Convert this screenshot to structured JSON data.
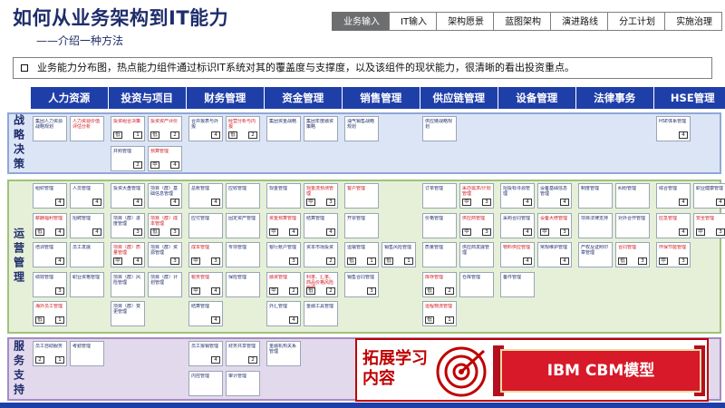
{
  "title": "如何从业务架构到IT能力",
  "subtitle": "——介绍一种方法",
  "process_steps": [
    "业务输入",
    "IT输入",
    "架构愿景",
    "蓝图架构",
    "演进路线",
    "分工计划",
    "实施治理"
  ],
  "active_step": 0,
  "note": "业务能力分布图，热点能力组件通过标识IT系统对其的覆盖度与支撑度，以及该组件的现状能力，很清晰的看出投资重点。",
  "columns": [
    "人力资源",
    "投资与项目",
    "财务管理",
    "资金管理",
    "销售管理",
    "供应链管理",
    "设备管理",
    "法律事务",
    "HSE管理"
  ],
  "bands": [
    {
      "name": "战略决策",
      "key": "strategy"
    },
    {
      "name": "运营管理",
      "key": "ops"
    },
    {
      "name": "服务支持",
      "key": "support"
    }
  ],
  "cells": [
    {
      "b": "strategy",
      "c": 0,
      "r": 0,
      "name": "集团人力资源战略规划",
      "hot": false,
      "l": "",
      "v": ""
    },
    {
      "b": "strategy",
      "c": 0,
      "r": 0,
      "name": "人力资源价值评估分析",
      "hot": true,
      "l": "",
      "v": ""
    },
    {
      "b": "strategy",
      "c": 1,
      "r": 0,
      "name": "投资组合决策",
      "hot": true,
      "l": "低",
      "v": "1"
    },
    {
      "b": "strategy",
      "c": 1,
      "r": 0,
      "name": "投资资产评价",
      "hot": true,
      "l": "低",
      "v": "2"
    },
    {
      "b": "strategy",
      "c": 1,
      "r": 1,
      "name": "并购管理",
      "hot": false,
      "l": "",
      "v": "2"
    },
    {
      "b": "strategy",
      "c": 1,
      "r": 1,
      "name": "预算管理",
      "hot": true,
      "l": "中",
      "v": "4"
    },
    {
      "b": "strategy",
      "c": 2,
      "r": 0,
      "name": "合并报表与外报",
      "hot": false,
      "l": "",
      "v": "4"
    },
    {
      "b": "strategy",
      "c": 2,
      "r": 0,
      "name": "经营分析与内报",
      "hot": true,
      "l": "低",
      "v": "2"
    },
    {
      "b": "strategy",
      "c": 3,
      "r": 0,
      "name": "集团资金战略",
      "hot": false,
      "l": "",
      "v": ""
    },
    {
      "b": "strategy",
      "c": 3,
      "r": 0,
      "name": "集团年度融资策略",
      "hot": false,
      "l": "",
      "v": ""
    },
    {
      "b": "strategy",
      "c": 4,
      "r": 0,
      "name": "油气销售战略规划",
      "hot": false,
      "l": "",
      "v": ""
    },
    {
      "b": "strategy",
      "c": 5,
      "r": 0,
      "name": "供应链战略规划",
      "hot": false,
      "l": "",
      "v": ""
    },
    {
      "b": "strategy",
      "c": 8,
      "r": 0,
      "name": "HSE体系管理",
      "hot": false,
      "l": "",
      "v": "4"
    },
    {
      "b": "ops",
      "c": 0,
      "r": 0,
      "name": "组织管理",
      "hot": false,
      "l": "",
      "v": "4"
    },
    {
      "b": "ops",
      "c": 0,
      "r": 0,
      "name": "人员管理",
      "hot": false,
      "l": "",
      "v": "4"
    },
    {
      "b": "ops",
      "c": 0,
      "r": 1,
      "name": "薪酬福利管理",
      "hot": true,
      "l": "低",
      "v": "4"
    },
    {
      "b": "ops",
      "c": 0,
      "r": 1,
      "name": "招聘管理",
      "hot": false,
      "l": "",
      "v": "4"
    },
    {
      "b": "ops",
      "c": 0,
      "r": 2,
      "name": "培训管理",
      "hot": false,
      "l": "",
      "v": "4"
    },
    {
      "b": "ops",
      "c": 0,
      "r": 2,
      "name": "员工发展",
      "hot": false,
      "l": "",
      "v": ""
    },
    {
      "b": "ops",
      "c": 0,
      "r": 3,
      "name": "绩效管理",
      "hot": false,
      "l": "",
      "v": "3"
    },
    {
      "b": "ops",
      "c": 0,
      "r": 3,
      "name": "职业资格管理",
      "hot": false,
      "l": "",
      "v": ""
    },
    {
      "b": "ops",
      "c": 0,
      "r": 4,
      "name": "海外员工管理",
      "hot": true,
      "l": "低",
      "v": "1"
    },
    {
      "b": "ops",
      "c": 1,
      "r": 0,
      "name": "投资大盘管理",
      "hot": false,
      "l": "",
      "v": "4"
    },
    {
      "b": "ops",
      "c": 1,
      "r": 0,
      "name": "项目（群）基础信息管理",
      "hot": false,
      "l": "",
      "v": "4"
    },
    {
      "b": "ops",
      "c": 1,
      "r": 1,
      "name": "项目（群）进度管理",
      "hot": false,
      "l": "",
      "v": "3"
    },
    {
      "b": "ops",
      "c": 1,
      "r": 1,
      "name": "项目（群）成本管理",
      "hot": true,
      "l": "低",
      "v": "3"
    },
    {
      "b": "ops",
      "c": 1,
      "r": 2,
      "name": "项目（群）质量管理",
      "hot": true,
      "l": "中",
      "v": "4"
    },
    {
      "b": "ops",
      "c": 1,
      "r": 2,
      "name": "项目（群）资源管理",
      "hot": false,
      "l": "",
      "v": "3"
    },
    {
      "b": "ops",
      "c": 1,
      "r": 3,
      "name": "项目（群）风险管理",
      "hot": false,
      "l": "",
      "v": ""
    },
    {
      "b": "ops",
      "c": 1,
      "r": 3,
      "name": "项目（群）计划管理",
      "hot": false,
      "l": "",
      "v": ""
    },
    {
      "b": "ops",
      "c": 1,
      "r": 4,
      "name": "项目（群）变更管理",
      "hot": false,
      "l": "",
      "v": ""
    },
    {
      "b": "ops",
      "c": 2,
      "r": 0,
      "name": "总账管理",
      "hot": false,
      "l": "",
      "v": "4"
    },
    {
      "b": "ops",
      "c": 2,
      "r": 0,
      "name": "应收管理",
      "hot": false,
      "l": "",
      "v": ""
    },
    {
      "b": "ops",
      "c": 2,
      "r": 1,
      "name": "应付管理",
      "hot": false,
      "l": "",
      "v": ""
    },
    {
      "b": "ops",
      "c": 2,
      "r": 1,
      "name": "固定资产管理",
      "hot": false,
      "l": "",
      "v": ""
    },
    {
      "b": "ops",
      "c": 2,
      "r": 2,
      "name": "成本管理",
      "hot": true,
      "l": "中",
      "v": "3"
    },
    {
      "b": "ops",
      "c": 2,
      "r": 2,
      "name": "专项管理",
      "hot": false,
      "l": "",
      "v": ""
    },
    {
      "b": "ops",
      "c": 2,
      "r": 3,
      "name": "税务管理",
      "hot": true,
      "l": "中",
      "v": "4"
    },
    {
      "b": "ops",
      "c": 2,
      "r": 3,
      "name": "保险管理",
      "hot": false,
      "l": "",
      "v": ""
    },
    {
      "b": "ops",
      "c": 2,
      "r": 4,
      "name": "结算管理",
      "hot": false,
      "l": "",
      "v": "4"
    },
    {
      "b": "ops",
      "c": 3,
      "r": 0,
      "name": "现金管理",
      "hot": false,
      "l": "",
      "v": ""
    },
    {
      "b": "ops",
      "c": 3,
      "r": 0,
      "name": "现金流预测管理",
      "hot": true,
      "l": "中",
      "v": "3"
    },
    {
      "b": "ops",
      "c": 3,
      "r": 1,
      "name": "资金预算管理",
      "hot": true,
      "l": "中",
      "v": "4"
    },
    {
      "b": "ops",
      "c": 3,
      "r": 1,
      "name": "结算管理",
      "hot": false,
      "l": "",
      "v": "4"
    },
    {
      "b": "ops",
      "c": 3,
      "r": 2,
      "name": "银行账户管理",
      "hot": false,
      "l": "",
      "v": "3"
    },
    {
      "b": "ops",
      "c": 3,
      "r": 2,
      "name": "资本市场投资",
      "hot": false,
      "l": "",
      "v": "2"
    },
    {
      "b": "ops",
      "c": 3,
      "r": 3,
      "name": "融资管理",
      "hot": true,
      "l": "中",
      "v": "2"
    },
    {
      "b": "ops",
      "c": 3,
      "r": 3,
      "name": "利率、汇率、商品价格风险管理",
      "hot": true,
      "l": "低",
      "v": "2"
    },
    {
      "b": "ops",
      "c": 3,
      "r": 4,
      "name": "外汇管理",
      "hot": false,
      "l": "",
      "v": "4"
    },
    {
      "b": "ops",
      "c": 3,
      "r": 4,
      "name": "金融工具管理",
      "hot": false,
      "l": "",
      "v": ""
    },
    {
      "b": "ops",
      "c": 4,
      "r": 0,
      "name": "客户管理",
      "hot": true,
      "l": "",
      "v": ""
    },
    {
      "b": "ops",
      "c": 4,
      "r": 1,
      "name": "开票管理",
      "hot": false,
      "l": "",
      "v": ""
    },
    {
      "b": "ops",
      "c": 4,
      "r": 2,
      "name": "运输管理",
      "hot": false,
      "l": "低",
      "v": "1"
    },
    {
      "b": "ops",
      "c": 4,
      "r": 2,
      "name": "销售风险管理",
      "hot": false,
      "l": "低",
      "v": "1"
    },
    {
      "b": "ops",
      "c": 4,
      "r": 3,
      "name": "销售合同管理",
      "hot": false,
      "l": "",
      "v": "3"
    },
    {
      "b": "ops",
      "c": 5,
      "r": 0,
      "name": "订单管理",
      "hot": false,
      "l": "",
      "v": ""
    },
    {
      "b": "ops",
      "c": 5,
      "r": 0,
      "name": "采办需求/计划管理",
      "hot": true,
      "l": "中",
      "v": "3"
    },
    {
      "b": "ops",
      "c": 5,
      "r": 1,
      "name": "价格管理",
      "hot": false,
      "l": "",
      "v": ""
    },
    {
      "b": "ops",
      "c": 5,
      "r": 1,
      "name": "供应商管理",
      "hot": true,
      "l": "中",
      "v": "3"
    },
    {
      "b": "ops",
      "c": 5,
      "r": 2,
      "name": "质量管理",
      "hot": false,
      "l": "",
      "v": ""
    },
    {
      "b": "ops",
      "c": 5,
      "r": 2,
      "name": "供应商发展管理",
      "hot": false,
      "l": "",
      "v": ""
    },
    {
      "b": "ops",
      "c": 5,
      "r": 3,
      "name": "库存管理",
      "hot": true,
      "l": "低",
      "v": "2"
    },
    {
      "b": "ops",
      "c": 5,
      "r": 3,
      "name": "仓库管理",
      "hot": false,
      "l": "",
      "v": ""
    },
    {
      "b": "ops",
      "c": 5,
      "r": 4,
      "name": "运程物流管理",
      "hot": true,
      "l": "低",
      "v": "1"
    },
    {
      "b": "ops",
      "c": 6,
      "r": 0,
      "name": "招投标寻源管理",
      "hot": false,
      "l": "",
      "v": "4"
    },
    {
      "b": "ops",
      "c": 6,
      "r": 0,
      "name": "设备基础信息管理",
      "hot": false,
      "l": "",
      "v": "4"
    },
    {
      "b": "ops",
      "c": 6,
      "r": 1,
      "name": "采购合同管理",
      "hot": false,
      "l": "",
      "v": "4"
    },
    {
      "b": "ops",
      "c": 6,
      "r": 1,
      "name": "设备大修管理",
      "hot": true,
      "l": "中",
      "v": "3"
    },
    {
      "b": "ops",
      "c": 6,
      "r": 2,
      "name": "物料供应管理",
      "hot": true,
      "l": "",
      "v": "4"
    },
    {
      "b": "ops",
      "c": 6,
      "r": 2,
      "name": "常规维护管理",
      "hot": false,
      "l": "",
      "v": "4"
    },
    {
      "b": "ops",
      "c": 6,
      "r": 3,
      "name": "备件管理",
      "hot": false,
      "l": "",
      "v": ""
    },
    {
      "b": "ops",
      "c": 7,
      "r": 0,
      "name": "制度管理",
      "hot": false,
      "l": "",
      "v": ""
    },
    {
      "b": "ops",
      "c": 7,
      "r": 0,
      "name": "纠纷管理",
      "hot": false,
      "l": "",
      "v": ""
    },
    {
      "b": "ops",
      "c": 7,
      "r": 1,
      "name": "项目法律支持",
      "hot": false,
      "l": "",
      "v": ""
    },
    {
      "b": "ops",
      "c": 7,
      "r": 1,
      "name": "对外合作管理",
      "hot": false,
      "l": "",
      "v": ""
    },
    {
      "b": "ops",
      "c": 7,
      "r": 2,
      "name": "产权及证照印章管理",
      "hot": false,
      "l": "",
      "v": ""
    },
    {
      "b": "ops",
      "c": 7,
      "r": 2,
      "name": "合同管理",
      "hot": true,
      "l": "低",
      "v": "3"
    },
    {
      "b": "ops",
      "c": 8,
      "r": 0,
      "name": "综合管理",
      "hot": false,
      "l": "",
      "v": "4"
    },
    {
      "b": "ops",
      "c": 8,
      "r": 0,
      "name": "职业健康管理",
      "hot": false,
      "l": "",
      "v": "4"
    },
    {
      "b": "ops",
      "c": 8,
      "r": 1,
      "name": "应急管理",
      "hot": true,
      "l": "",
      "v": "4"
    },
    {
      "b": "ops",
      "c": 8,
      "r": 1,
      "name": "安全管理",
      "hot": true,
      "l": "中",
      "v": "3"
    },
    {
      "b": "ops",
      "c": 8,
      "r": 2,
      "name": "环保节能管理",
      "hot": true,
      "l": "中",
      "v": "3"
    },
    {
      "b": "support",
      "c": 0,
      "r": 0,
      "name": "员工自助服务",
      "hot": false,
      "l": "2",
      "v": "1"
    },
    {
      "b": "support",
      "c": 0,
      "r": 0,
      "name": "考勤管理",
      "hot": false,
      "l": "",
      "v": ""
    },
    {
      "b": "support",
      "c": 2,
      "r": 0,
      "name": "员工报销管理",
      "hot": false,
      "l": "",
      "v": "4"
    },
    {
      "b": "support",
      "c": 2,
      "r": 0,
      "name": "财务共享管理",
      "hot": false,
      "l": "",
      "v": "2"
    },
    {
      "b": "support",
      "c": 2,
      "r": 1,
      "name": "内控管理",
      "hot": false,
      "l": "",
      "v": ""
    },
    {
      "b": "support",
      "c": 2,
      "r": 1,
      "name": "审计管理",
      "hot": false,
      "l": "",
      "v": ""
    },
    {
      "b": "support",
      "c": 3,
      "r": 0,
      "name": "金融机构关系管理",
      "hot": false,
      "l": "",
      "v": ""
    }
  ],
  "callout_text": "拓展学习内容",
  "banner_text": "IBM CBM模型",
  "colors": {
    "header": "#1f3fa8",
    "hot": "#d0161e",
    "accent": "#c00000"
  }
}
